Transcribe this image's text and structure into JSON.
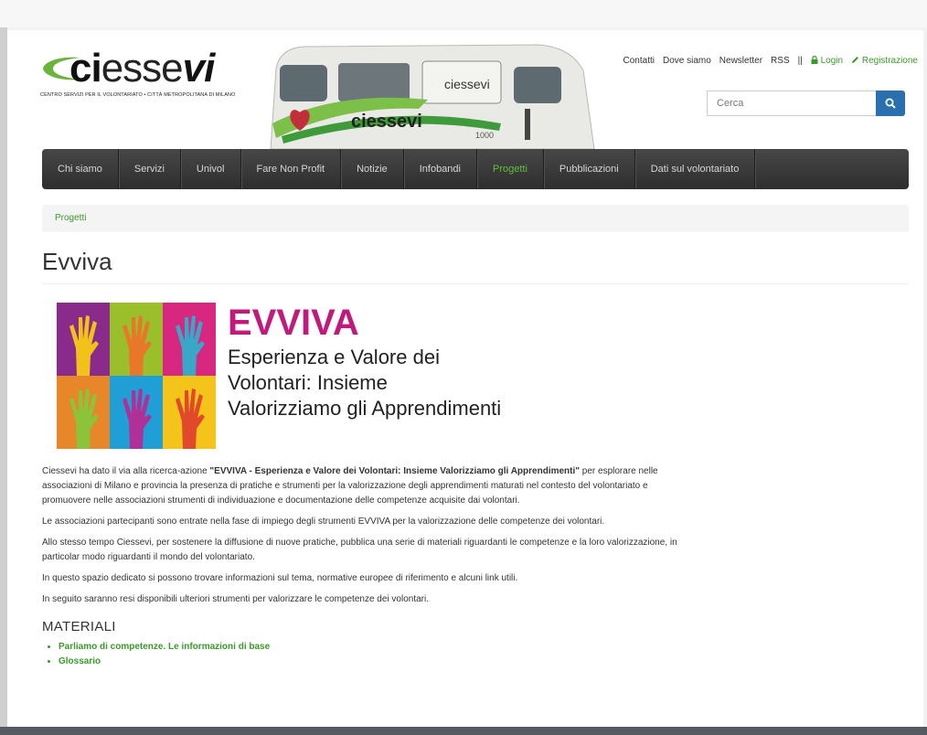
{
  "header": {
    "logo_part1": "ci",
    "logo_part2": "esse",
    "logo_part3": "vi",
    "tagline": "CENTRO SERVIZI PER IL VOLONTARIATO • CITTÀ METROPOLITANA DI MILANO",
    "van_logo": "ciessevi",
    "van_number": "1000",
    "top_links": [
      {
        "label": "Contatti"
      },
      {
        "label": "Dove siamo"
      },
      {
        "label": "Newsletter"
      },
      {
        "label": "RSS"
      },
      {
        "label": "||"
      },
      {
        "label": "Login",
        "icon": "lock-icon"
      },
      {
        "label": "Registrazione",
        "icon": "pencil-icon"
      }
    ],
    "search": {
      "placeholder": "Cerca",
      "icon": "search-icon"
    }
  },
  "nav": {
    "items": [
      {
        "label": "Chi siamo"
      },
      {
        "label": "Servizi"
      },
      {
        "label": "Univol"
      },
      {
        "label": "Fare Non Profit"
      },
      {
        "label": "Notizie"
      },
      {
        "label": "Infobandi"
      },
      {
        "label": "Progetti",
        "active": true
      },
      {
        "label": "Pubblicazioni"
      },
      {
        "label": "Dati sul volontariato"
      }
    ],
    "active_color": "#5fbf3a"
  },
  "breadcrumb": {
    "label": "Progetti"
  },
  "page": {
    "title": "Evviva"
  },
  "banner": {
    "headline": "EVVIVA",
    "subline": "Esperienza e Valore dei Volontari: Insieme Valorizziamo gli Apprendimenti",
    "tiles": [
      {
        "bg": "#8a2a8a",
        "hand": "#f2c21b"
      },
      {
        "bg": "#9bbf2a",
        "hand": "#e8772a"
      },
      {
        "bg": "#d8277e",
        "hand": "#3aa6c8"
      },
      {
        "bg": "#e8862a",
        "hand": "#8bc43a"
      },
      {
        "bg": "#1f9fd5",
        "hand": "#b0309a"
      },
      {
        "bg": "#f4c41a",
        "hand": "#e04a2a"
      }
    ],
    "accent": "#c01a7c"
  },
  "content": {
    "p1_before": "Ciessevi ha dato il via alla ricerca-azione ",
    "p1_bold": "\"EVVIVA - Esperienza e Valore dei Volontari: Insieme Valorizziamo gli Apprendimenti\"",
    "p1_after": " per esplorare nelle associazioni di Milano e provincia la presenza di pratiche e strumenti per la valorizzazione degli apprendimenti maturati nel contesto del volontariato e promuovere nelle associazioni strumenti di individuazione e documentazione delle competenze acquisite dai volontari.",
    "p2": "Le associazioni partecipanti sono entrate nella fase di impiego degli strumenti EVVIVA per la valorizzazione delle competenze dei volontari.",
    "p3": "Allo stesso tempo Ciessevi, per sostenere la diffusione di nuove pratiche, pubblica una serie di materiali riguardanti le competenze e la loro valorizzazione, in particolar modo riguardanti il mondo del volontariato.",
    "p4": "In questo spazio dedicato si possono trovare informazioni sul tema, normative europee di riferimento e alcuni link utili.",
    "p5": "In seguito saranno resi disponibili ulteriori strumenti per valorizzare le competenze dei volontari."
  },
  "materials": {
    "heading": "MATERIALI",
    "items": [
      {
        "label": "Parliamo di competenze. Le informazioni di base"
      },
      {
        "label": "Glossario"
      }
    ],
    "link_color": "#3a9a2a"
  }
}
